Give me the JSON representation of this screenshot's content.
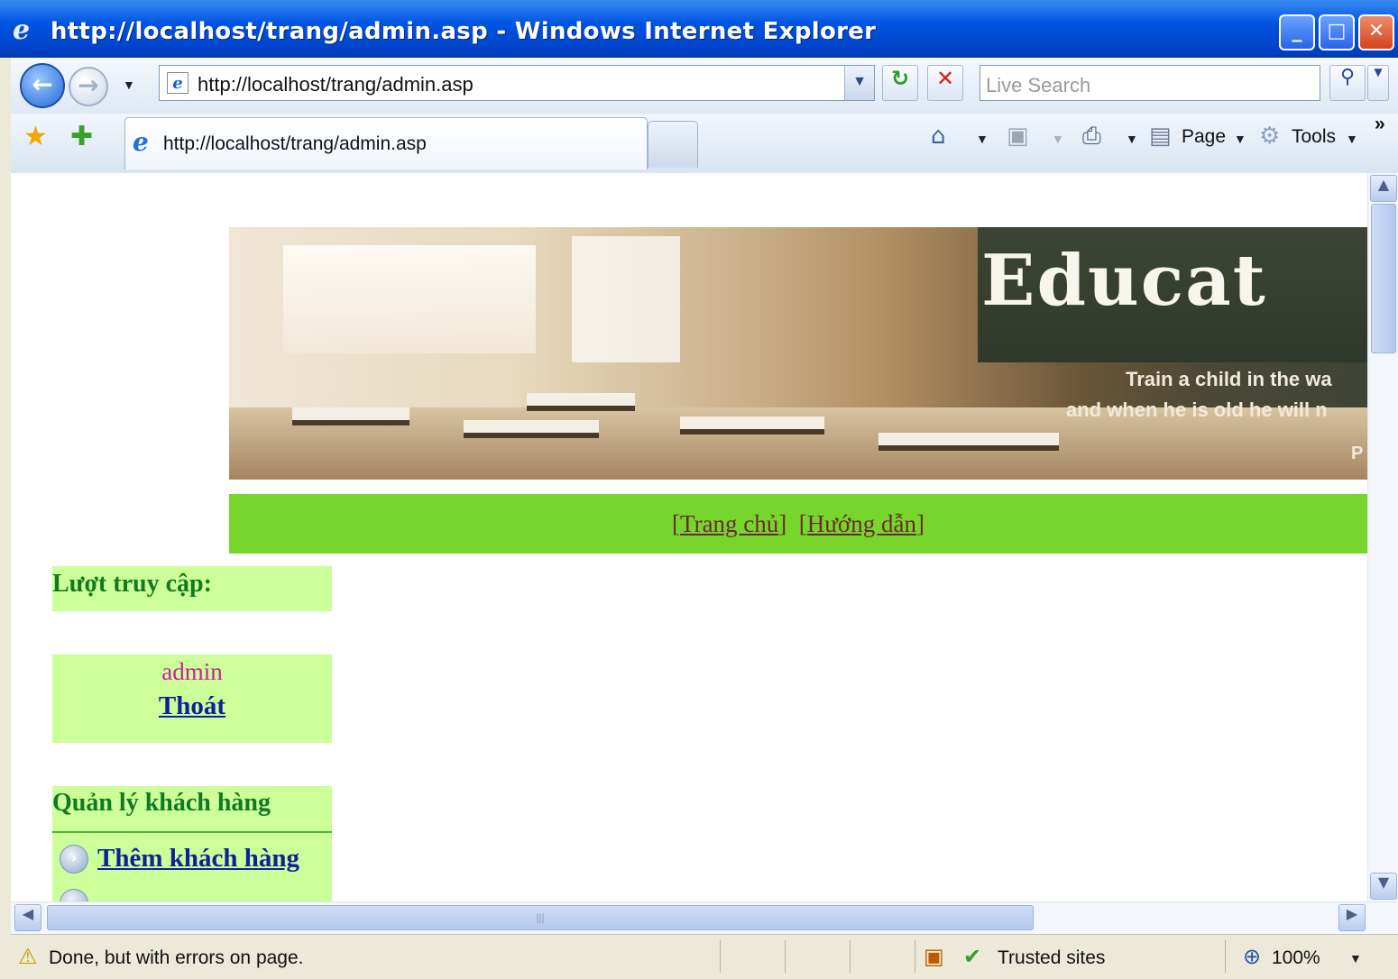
{
  "window": {
    "title": "http://localhost/trang/admin.asp - Windows Internet Explorer"
  },
  "nav": {
    "address": "http://localhost/trang/admin.asp",
    "search_placeholder": "Live Search"
  },
  "tabs": [
    {
      "label": "http://localhost/trang/admin.asp"
    }
  ],
  "toolbar": {
    "page_label": "Page",
    "tools_label": "Tools",
    "chevron": "»"
  },
  "banner": {
    "title": "Educat",
    "quote_line1": "Train a child in the wa",
    "quote_line2": "and when he is old he will n",
    "quote_line3": "P"
  },
  "menu": {
    "home": "Trang chủ",
    "guide": "Hướng dẫn"
  },
  "sidebar": {
    "visits_label": "Lượt truy cập:",
    "username": "admin",
    "logout": "Thoát",
    "section_title": "Quản lý khách hàng",
    "items": [
      {
        "label": "Thêm khách hàng"
      }
    ]
  },
  "status": {
    "message": "Done, but with errors on page.",
    "zone": "Trusted sites",
    "zoom": "100%"
  },
  "colors": {
    "menu_bg": "#77d62c",
    "box_bg": "#ccff99",
    "heading": "#117a1e",
    "link": "#10209a",
    "username": "#c81e9e"
  }
}
